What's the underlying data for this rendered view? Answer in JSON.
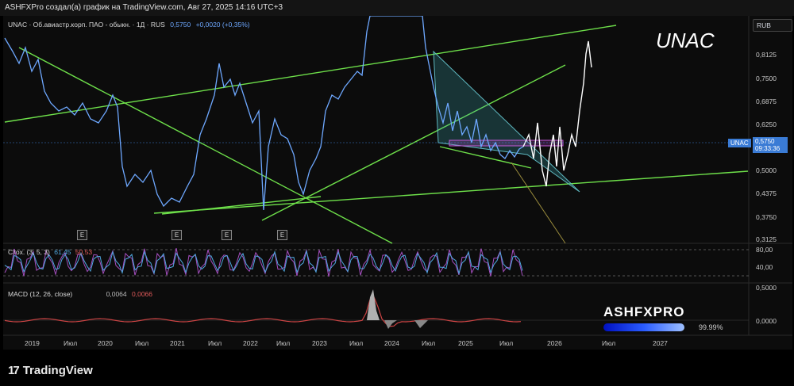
{
  "header": {
    "caption": "ASHFXPro создал(а) график на TradingView.com, Авг 27, 2025 14:16 UTC+3"
  },
  "main_legend": {
    "symbol": "UNAC · Об.авиастр.корп. ПАО - обыкн. · 1Д · RUS",
    "price": "0,5750",
    "change": "+0,0020 (+0,35%)"
  },
  "currency_button": "RUB",
  "watermark_title": "UNAC",
  "price_axis": [
    "0,8125",
    "0,7500",
    "0,6875",
    "0,6250",
    "0,5000",
    "0,4375",
    "0,3750",
    "0,3125"
  ],
  "price_tag": {
    "symbol": "UNAC",
    "price": "0,5750",
    "countdown": "09:33:36"
  },
  "stoch": {
    "label": "Стох. (3, 5, 3)",
    "k": "61,45",
    "d": "50,53",
    "axis": [
      "80,00",
      "40,00"
    ]
  },
  "macd": {
    "label": "MACD (12, 26, close)",
    "v1": "0,0064",
    "v2": "0,0066",
    "axis": [
      "0,5000",
      "0,0000"
    ]
  },
  "earnings_marker": "E",
  "time_axis": [
    "2019",
    "Июл",
    "2020",
    "Июл",
    "2021",
    "Июл",
    "2022",
    "Июл",
    "2023",
    "Июл",
    "2024",
    "Июл",
    "2025",
    "Июл",
    "2026",
    "Июл",
    "2027"
  ],
  "brand": {
    "name": "ASHFXPRO",
    "percent": "99.99%"
  },
  "footer": {
    "logo_text": "TradingView",
    "logo_mark": "17"
  },
  "colors": {
    "price_line": "#6ea8ff",
    "trendlines": "#6ee04a",
    "stoch_k": "#a64fc0",
    "stoch_d": "#4fa8e0",
    "macd_hist": "#c44",
    "tag_bg": "#3a7bd5"
  }
}
